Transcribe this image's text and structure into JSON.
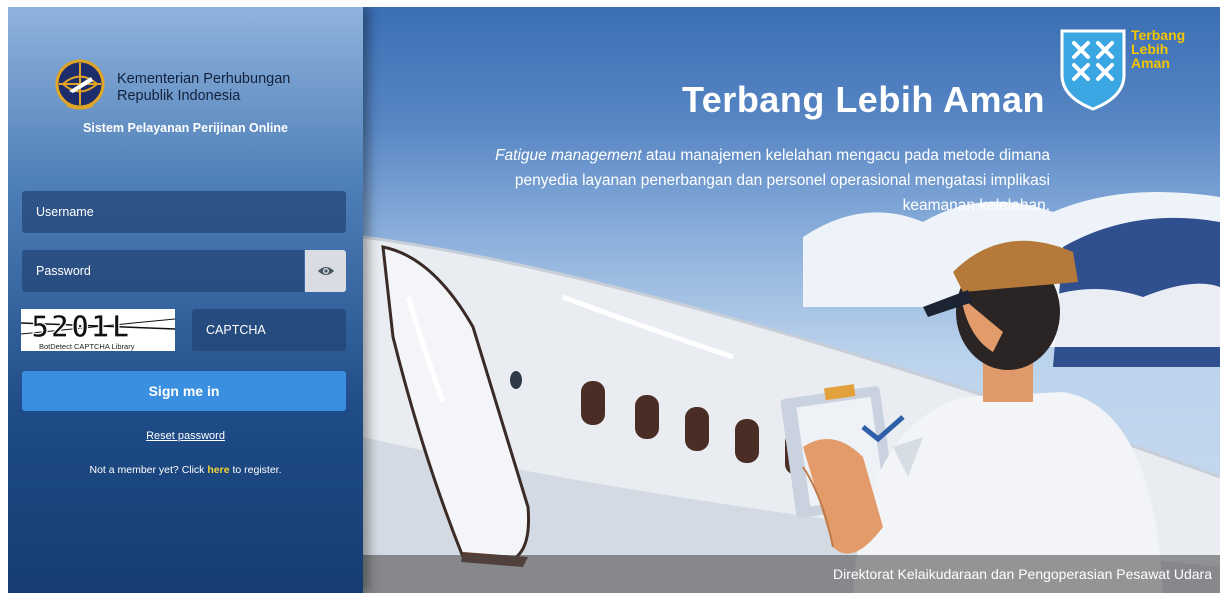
{
  "header": {
    "org_line1": "Kementerian Perhubungan",
    "org_line2": "Republik Indonesia",
    "app_name": "Sistem Pelayanan Perijinan Online"
  },
  "form": {
    "username_placeholder": "Username",
    "password_placeholder": "Password",
    "captcha_code": "5201L",
    "captcha_caption": "BotDetect CAPTCHA Library",
    "captcha_placeholder": "CAPTCHA",
    "signin_label": "Sign me in",
    "reset_label": "Reset password",
    "register_prefix": "Not a member yet? Click ",
    "register_link": "here",
    "register_suffix": " to register."
  },
  "hero": {
    "title": "Terbang Lebih Aman",
    "text_em": "Fatigue management",
    "text_rest": " atau manajemen kelelahan mengacu pada metode dimana penyedia layanan penerbangan dan personel operasional mengatasi implikasi keamanan kelelahan.",
    "badge_line1": "Terbang",
    "badge_line2": "Lebih",
    "badge_line3": "Aman",
    "footer": "Direktorat Kelaikudaraan dan Pengoperasian Pesawat Udara"
  },
  "icons": {
    "logo": "ministry-emblem-icon",
    "show_password": "eye-icon",
    "badge": "shield-badge-icon"
  },
  "colors": {
    "signin": "#3b8fe0",
    "link_highlight": "#f5d33b",
    "badge_text": "#f5c400"
  }
}
